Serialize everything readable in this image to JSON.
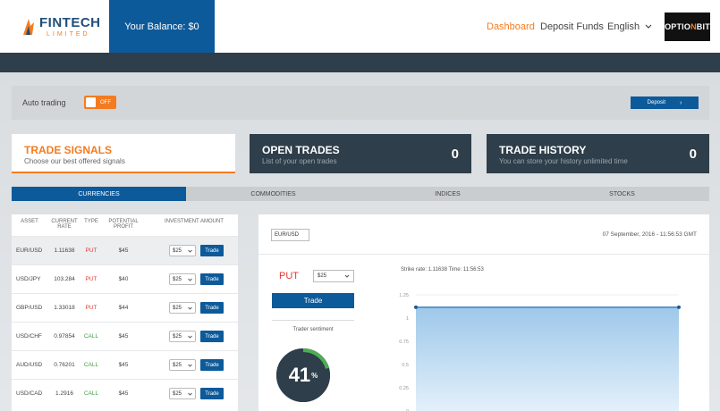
{
  "header": {
    "logo_text": "FINTECH",
    "logo_sub": "LIMITED",
    "balance": "Your Balance: $0",
    "nav": {
      "dashboard": "Dashboard",
      "deposit_funds": "Deposit Funds",
      "language": "English"
    },
    "brand_prefix": "OPTIO",
    "brand_mark": "N",
    "brand_suffix": "BIT"
  },
  "autobar": {
    "label": "Auto trading",
    "toggle_state": "OFF",
    "deposit_label": "Deposit"
  },
  "cards": {
    "signals": {
      "title": "TRADE SIGNALS",
      "subtitle": "Choose our best offered signals"
    },
    "open": {
      "title": "OPEN TRADES",
      "subtitle": "List of your open trades",
      "count": "0"
    },
    "history": {
      "title": "TRADE HISTORY",
      "subtitle": "You can store your history unlimited time",
      "count": "0"
    }
  },
  "tabs": [
    "CURRENCIES",
    "COMMODITIES",
    "INDICES",
    "STOCKS"
  ],
  "assets": {
    "headers": {
      "asset": "ASSET",
      "rate": "CURRENT RATE",
      "type": "TYPE",
      "profit": "POTENTIAL PROFIT",
      "amount": "INVESTMENT AMOUNT"
    },
    "rows": [
      {
        "asset": "EUR/USD",
        "rate": "1.11638",
        "type": "PUT",
        "profit": "$45",
        "amount": "$25",
        "action": "Trade"
      },
      {
        "asset": "USD/JPY",
        "rate": "103.284",
        "type": "PUT",
        "profit": "$40",
        "amount": "$25",
        "action": "Trade"
      },
      {
        "asset": "GBP/USD",
        "rate": "1.33018",
        "type": "PUT",
        "profit": "$44",
        "amount": "$25",
        "action": "Trade"
      },
      {
        "asset": "USD/CHF",
        "rate": "0.97854",
        "type": "CALL",
        "profit": "$45",
        "amount": "$25",
        "action": "Trade"
      },
      {
        "asset": "AUD/USD",
        "rate": "0.76201",
        "type": "CALL",
        "profit": "$45",
        "amount": "$25",
        "action": "Trade"
      },
      {
        "asset": "USD/CAD",
        "rate": "1.2916",
        "type": "CALL",
        "profit": "$45",
        "amount": "$25",
        "action": "Trade"
      }
    ]
  },
  "panel": {
    "pair": "EUR/USD",
    "date": "07 September, 2016 - 11:56:53 GMT",
    "direction": "PUT",
    "amount": "$25",
    "trade_label": "Trade",
    "sentiment_label": "Trader sentiment",
    "sentiment_value": "41",
    "sentiment_unit": "%",
    "sentiment_fraction": 0.41,
    "strike_text": "Strike rate: 1.11638 Time: 11:56:53"
  },
  "colors": {
    "accent": "#f47c20",
    "primary": "#0d5a9a",
    "dark": "#2e3e4a",
    "put": "#e53935",
    "call": "#43a047"
  },
  "chart_data": {
    "type": "area",
    "y_ticks": [
      "1.25",
      "1",
      "0.75",
      "0.5",
      "0.25",
      "0"
    ],
    "ylim": [
      0,
      1.25
    ],
    "x": [
      0,
      1
    ],
    "values": [
      1.11638,
      1.11638
    ]
  }
}
